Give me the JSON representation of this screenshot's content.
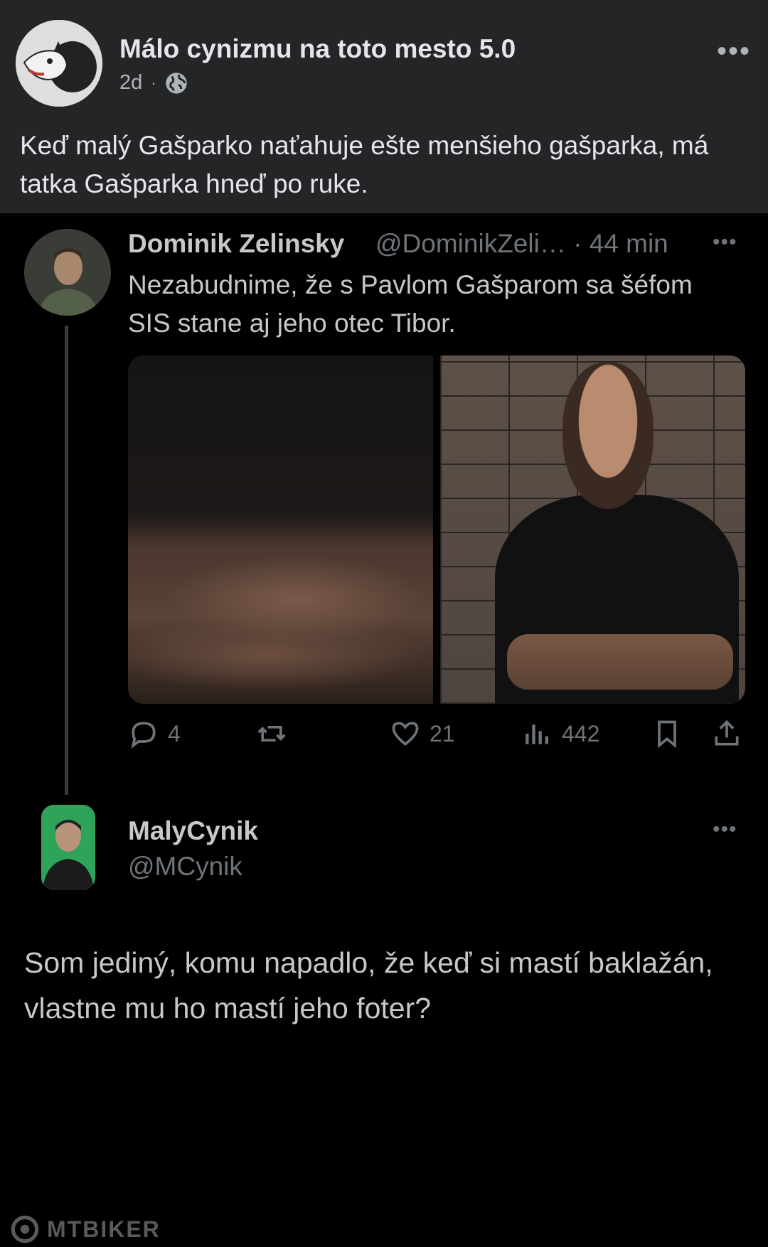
{
  "post": {
    "page_name": "Málo cynizmu na toto mesto 5.0",
    "age": "2d",
    "separator": "·",
    "more": "•••",
    "text": "Keď malý Gašparko naťahuje ešte menšieho gašparka, má tatka Gašparka hneď po ruke."
  },
  "tweet1": {
    "name": "Dominik Zelinsky",
    "handle": "@DominikZeli… · 44 min",
    "more": "•••",
    "text": "Nezabudnime, že s Pavlom Gašparom sa šéfom SIS stane aj jeho otec Tibor.",
    "stats": {
      "replies": "4",
      "likes": "21",
      "views": "442"
    }
  },
  "tweet2": {
    "name": "MalyCynik",
    "handle": "@MCynik",
    "more": "•••",
    "text": "Som jediný, komu napadlo, že keď si mastí baklažán, vlastne mu ho mastí jeho foter?"
  },
  "watermark": "MTBIKER",
  "icons": {
    "globe": "globe-icon",
    "reply": "reply-icon",
    "retweet": "retweet-icon",
    "like": "heart-icon",
    "views": "views-icon",
    "bookmark": "bookmark-icon",
    "share": "share-icon"
  }
}
